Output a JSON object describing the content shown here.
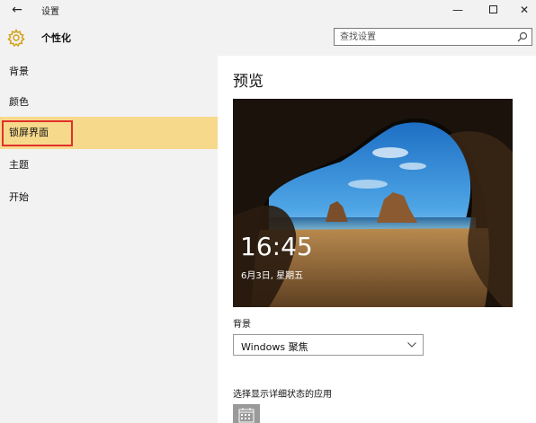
{
  "window": {
    "title": "设置",
    "back_glyph": "←",
    "minimize_glyph": "—",
    "close_glyph": "✕"
  },
  "header": {
    "icon": "gear-icon",
    "title": "个性化",
    "search_placeholder": "查找设置"
  },
  "sidebar": {
    "items": [
      {
        "label": "背景"
      },
      {
        "label": "颜色"
      },
      {
        "label": "锁屏界面"
      },
      {
        "label": "主题"
      },
      {
        "label": "开始"
      }
    ],
    "selected_index": 2
  },
  "main": {
    "preview_title": "预览",
    "lock_time": "16:45",
    "lock_date": "6月3日, 星期五",
    "background_label": "背景",
    "background_value": "Windows 聚焦",
    "apps_label": "选择显示详细状态的应用",
    "app_icon": "calendar-icon"
  },
  "colors": {
    "accent_gear": "#d4a017",
    "selected_bg": "#f7d98c",
    "highlight_outline": "#e0302b"
  }
}
